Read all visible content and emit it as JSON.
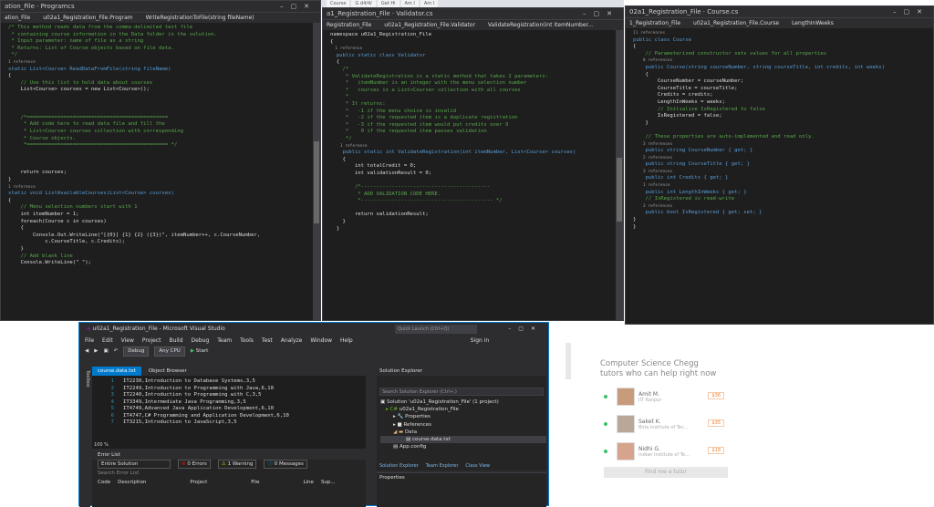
{
  "win1": {
    "title": "ation_File · Programcs",
    "nav": [
      "ation_File",
      "u02a1_Registration_File.Program",
      "WriteRegistrationToFile(string fileName)"
    ],
    "code": [
      [
        "cm",
        "/* This method reads data from the comma-delimited text file"
      ],
      [
        "cm",
        " * containing course information in the Data folder in the solution."
      ],
      [
        "cm",
        " * Input parameter: name of file as a string"
      ],
      [
        "cm",
        " * Returns: List of Course objects based on file data."
      ],
      [
        "cm",
        " */"
      ],
      [
        "ref",
        "1 reference"
      ],
      [
        "kw",
        "static List<Course> ReadDataFromFile(string fileName)"
      ],
      [
        "tx",
        "{"
      ],
      [
        "cm",
        "    // Use this list to hold data about courses"
      ],
      [
        "tx",
        "    List<Course> courses = new List<Course>();"
      ],
      [
        "tx",
        ""
      ],
      [
        "tx",
        ""
      ],
      [
        "tx",
        ""
      ],
      [
        "cm",
        "    /*=============================================="
      ],
      [
        "cm",
        "     * Add code here to read data file and fill the"
      ],
      [
        "cm",
        "     * List<Course> courses collection with corresponding"
      ],
      [
        "cm",
        "     * Course objects."
      ],
      [
        "cm",
        "     *============================================== */"
      ],
      [
        "tx",
        ""
      ],
      [
        "tx",
        ""
      ],
      [
        "tx",
        ""
      ],
      [
        "tx",
        "    return courses;"
      ],
      [
        "tx",
        "}"
      ],
      [
        "ref",
        "1 reference"
      ],
      [
        "kw",
        "static void ListAvailableCourses(List<Course> courses)"
      ],
      [
        "tx",
        "{"
      ],
      [
        "cm",
        "    // Menu selection numbers start with 1"
      ],
      [
        "tx",
        "    int itemNumber = 1;"
      ],
      [
        "tx",
        "    foreach(Course c in courses)"
      ],
      [
        "tx",
        "    {"
      ],
      [
        "tx",
        "        Console.Out.WriteLine(\"[{0}] {1} {2} ({3})\", itemNumber++, c.CourseNumber,"
      ],
      [
        "tx",
        "            c.CourseTitle, c.Credits);"
      ],
      [
        "tx",
        "    }"
      ],
      [
        "cm",
        "    // Add blank line"
      ],
      [
        "tx",
        "    Console.WriteLine(\" \");"
      ]
    ]
  },
  "browser_tabs": [
    "Course",
    "G d4/4/",
    "Get Hi",
    "Am I",
    "Am I"
  ],
  "win2": {
    "title": "a1_Registration_File · Validator.cs",
    "nav": [
      "Registration_File",
      "u02a1_Registration_File.Validator",
      "ValidateRegistration(int itemNumber..."
    ],
    "code": [
      [
        "tx",
        "namespace u02a1_Registration_File"
      ],
      [
        "tx",
        "{"
      ],
      [
        "ref",
        "  1 reference"
      ],
      [
        "kw",
        "  public static class Validator"
      ],
      [
        "tx",
        "  {"
      ],
      [
        "cm",
        "    /*"
      ],
      [
        "cm",
        "     * ValidateRegistration is a static method that takes 2 parameters:"
      ],
      [
        "cm",
        "     *   itemNumber is an integer with the menu selection number"
      ],
      [
        "cm",
        "     *   courses is a List<Course> collection with all courses"
      ],
      [
        "cm",
        "     *"
      ],
      [
        "cm",
        "     * It returns:"
      ],
      [
        "cm",
        "     *   -1 if the menu choice is invalid"
      ],
      [
        "cm",
        "     *   -2 if the requested item is a duplicate registration"
      ],
      [
        "cm",
        "     *   -3 if the requested item would put credits over 9"
      ],
      [
        "cm",
        "     *    0 if the requested item passes validation"
      ],
      [
        "cm",
        "     */"
      ],
      [
        "ref",
        "    1 reference"
      ],
      [
        "kw",
        "    public static int ValidateRegistration(int itemNumber, List<Course> courses)"
      ],
      [
        "tx",
        "    {"
      ],
      [
        "tx",
        "        int totalCredit = 0;"
      ],
      [
        "tx",
        "        int validationResult = 0;"
      ],
      [
        "tx",
        ""
      ],
      [
        "cm",
        "        /*------------------------------------------"
      ],
      [
        "cm",
        "         * ADD VALIDATION CODE HERE."
      ],
      [
        "cm",
        "         *------------------------------------------- */"
      ],
      [
        "tx",
        ""
      ],
      [
        "tx",
        "        return validationResult;"
      ],
      [
        "tx",
        "    }"
      ],
      [
        "tx",
        "  }"
      ]
    ]
  },
  "win3": {
    "title": "02a1_Registration_File · Course.cs",
    "nav": [
      "1_Registration_File",
      "u02a1_Registration_File.Course",
      "LengthInWeeks"
    ],
    "code": [
      [
        "ref",
        "11 references"
      ],
      [
        "kw",
        "public class Course"
      ],
      [
        "tx",
        "{"
      ],
      [
        "cm",
        "    // Parameterized constructor sets values for all properties"
      ],
      [
        "ref",
        "    0 references"
      ],
      [
        "kw",
        "    public Course(string courseNumber, string courseTitle, int credits, int weeks)"
      ],
      [
        "tx",
        "    {"
      ],
      [
        "tx",
        "        CourseNumber = courseNumber;"
      ],
      [
        "tx",
        "        CourseTitle = courseTitle;"
      ],
      [
        "tx",
        "        Credits = credits;"
      ],
      [
        "tx",
        "        LengthInWeeks = weeks;"
      ],
      [
        "cm",
        "        // Initialize IsRegistered to false"
      ],
      [
        "tx",
        "        IsRegistered = false;"
      ],
      [
        "tx",
        "    }"
      ],
      [
        "tx",
        ""
      ],
      [
        "cm",
        "    // These properties are auto-implemented and read only."
      ],
      [
        "ref",
        "    3 references"
      ],
      [
        "kw",
        "    public string CourseNumber { get; }"
      ],
      [
        "ref",
        "    2 references"
      ],
      [
        "kw",
        "    public string CourseTitle { get; }"
      ],
      [
        "ref",
        "    3 references"
      ],
      [
        "kw",
        "    public int Credits { get; }"
      ],
      [
        "ref",
        "    1 reference"
      ],
      [
        "kw",
        "    public int LengthInWeeks { get; }"
      ],
      [
        "cm",
        "    // IsRegistered is read-write"
      ],
      [
        "ref",
        "    3 references"
      ],
      [
        "kw",
        "    public bool IsRegistered { get; set; }"
      ],
      [
        "tx",
        "}"
      ],
      [
        "tx",
        "}"
      ]
    ]
  },
  "vs": {
    "title": "u02a1_Registration_File - Microsoft Visual Studio",
    "quick_launch": "Quick Launch (Ctrl+Q)",
    "sign_in": "Sign in",
    "menu": [
      "File",
      "Edit",
      "View",
      "Project",
      "Build",
      "Debug",
      "Team",
      "Tools",
      "Test",
      "Analyze",
      "Window",
      "Help"
    ],
    "config": "Debug",
    "platform": "Any CPU",
    "start": "Start",
    "toolbox": "Toolbox",
    "tabs": [
      "course.data.txt",
      "Object Browser"
    ],
    "lines": [
      "IT2230,Introduction to Database Systems,3,5",
      "IT2249,Introduction to Programming with Java,6,10",
      "IT2240,Introduction to Programming with C,3,5",
      "IT3349,Intermediate Java Programming,3,5",
      "IT4749,Advanced Java Application Development,6,10",
      "IT4747,C# Programming and Application Development,6,10",
      "IT3215,Introduction to JavaScript,3,5"
    ],
    "zoom": "100 %",
    "error_list": {
      "title": "Error List",
      "scope": "Entire Solution",
      "errors": "0 Errors",
      "warnings": "1 Warning",
      "messages": "0 Messages",
      "search": "Search Error List",
      "cols": [
        "Code",
        "Description",
        "Project",
        "File",
        "Line",
        "Sup..."
      ]
    },
    "solution": {
      "title": "Solution Explorer",
      "search": "Search Solution Explorer (Ctrl+;)",
      "items": [
        "Solution 'u02a1_Registration_File' (1 project)",
        "u02a1_Registration_File",
        "Properties",
        "References",
        "Data",
        "course.data.txt",
        "App.config"
      ],
      "tabs": [
        "Solution Explorer",
        "Team Explorer",
        "Class View"
      ],
      "props": "Properties"
    }
  },
  "chegg": {
    "heading": "Computer Science Chegg tutors who can help right now",
    "tutors": [
      {
        "name": "Amit M.",
        "school": "IIT Kanpur",
        "price": "$36"
      },
      {
        "name": "Saket K.",
        "school": "Birla Institute of Tec...",
        "price": "$35"
      },
      {
        "name": "Nidhi G.",
        "school": "Indian Institute of Te...",
        "price": "$18"
      }
    ],
    "button": "Find me a tutor"
  }
}
